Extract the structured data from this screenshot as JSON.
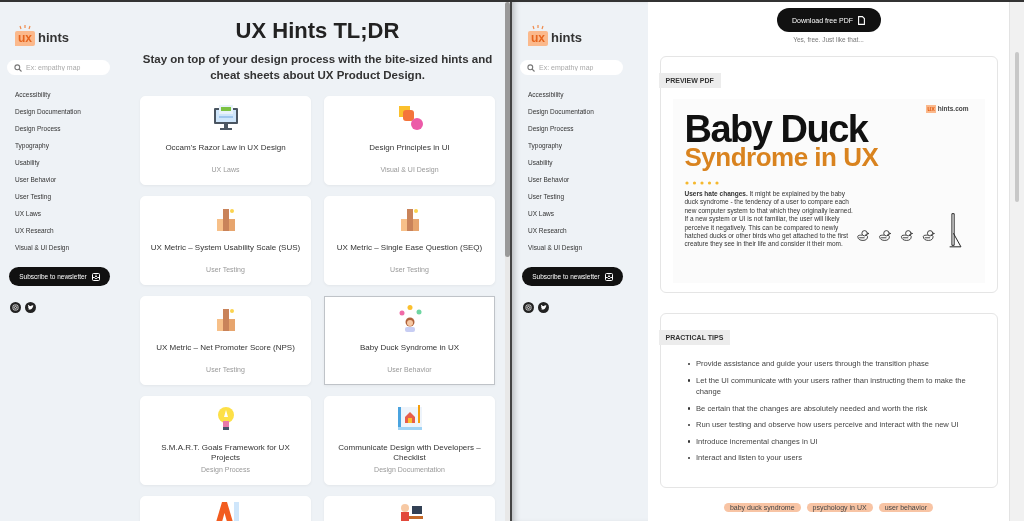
{
  "left_window": {
    "sidebar": {
      "logo_badge": "ux",
      "logo_text": "hints",
      "search": {
        "placeholder": "Ex: empathy map"
      },
      "nav": [
        "Accessibility",
        "Design Documentation",
        "Design Process",
        "Typography",
        "Usability",
        "User Behavior",
        "User Testing",
        "UX Laws",
        "UX Research",
        "Visual & UI Design"
      ],
      "subscribe_button": "Subscribe to newsletter"
    },
    "title": "UX Hints TL;DR",
    "subtitle": "Stay on top of your design process with the bite-sized hints and cheat sheets about UX Product Design.",
    "cards": [
      {
        "kind": "full",
        "title": "Occam's Razor Law in UX Design",
        "category": "UX Laws",
        "selected": false
      },
      {
        "kind": "full",
        "title": "Design Principles in UI",
        "category": "Visual & UI Design",
        "selected": false
      },
      {
        "kind": "full",
        "title": "UX Metric – System Usability Scale (SUS)",
        "category": "User Testing",
        "selected": false
      },
      {
        "kind": "full",
        "title": "UX Metric – Single Ease Question (SEQ)",
        "category": "User Testing",
        "selected": false
      },
      {
        "kind": "full",
        "title": "UX Metric – Net Promoter Score (NPS)",
        "category": "User Testing",
        "selected": false
      },
      {
        "kind": "full",
        "title": "Baby Duck Syndrome in UX",
        "category": "User Behavior",
        "selected": true
      },
      {
        "kind": "full",
        "title": "S.M.A.R.T. Goals Framework for UX Projects",
        "category": "Design Process",
        "selected": false
      },
      {
        "kind": "full",
        "title": "Communicate Design with Developers – Checklist",
        "category": "Design Documentation",
        "selected": false
      },
      {
        "kind": "partial",
        "selected": false
      },
      {
        "kind": "partial",
        "selected": false
      }
    ]
  },
  "right_window": {
    "sidebar": {
      "logo_badge": "ux",
      "logo_text": "hints",
      "search": {
        "placeholder": "Ex: empathy map"
      },
      "nav": [
        "Accessibility",
        "Design Documentation",
        "Design Process",
        "Typography",
        "Usability",
        "User Behavior",
        "User Testing",
        "UX Laws",
        "UX Research",
        "Visual & UI Design"
      ],
      "subscribe_button": "Subscribe to newsletter"
    },
    "download_button": "Download free PDF",
    "download_note": "Yes, free. Just like that...",
    "preview": {
      "label": "PREVIEW PDF",
      "poster": {
        "site_badge": "ux",
        "site": "hints.com",
        "title": "Baby Duck",
        "subtitle": "Syndrome in UX",
        "text": "**Users hate changes.** It might be explained by the baby duck syndrome - the tendency of a user to compare each new computer system to that which they originally learned. If a new system or UI is not familiar, the user will likely perceive it negatively. This can be compared to newly hatched ducks or other birds who get attached to the first creature they see in their life and consider it their mom."
      }
    },
    "tips": {
      "label": "PRACTICAL TIPS",
      "items": [
        "Provide assistance and guide your users through the transition phase",
        "Let the UI communicate with your users rather than instructing them to make the change",
        "Be certain that the changes are absolutely needed and worth the risk",
        "Run user testing and observe how users perceive and interact with the new UI",
        "Introduce incremental changes in UI",
        "Interact and listen to your users"
      ]
    },
    "tags": [
      "baby duck syndrome",
      "psychology in UX",
      "user behavior"
    ]
  }
}
